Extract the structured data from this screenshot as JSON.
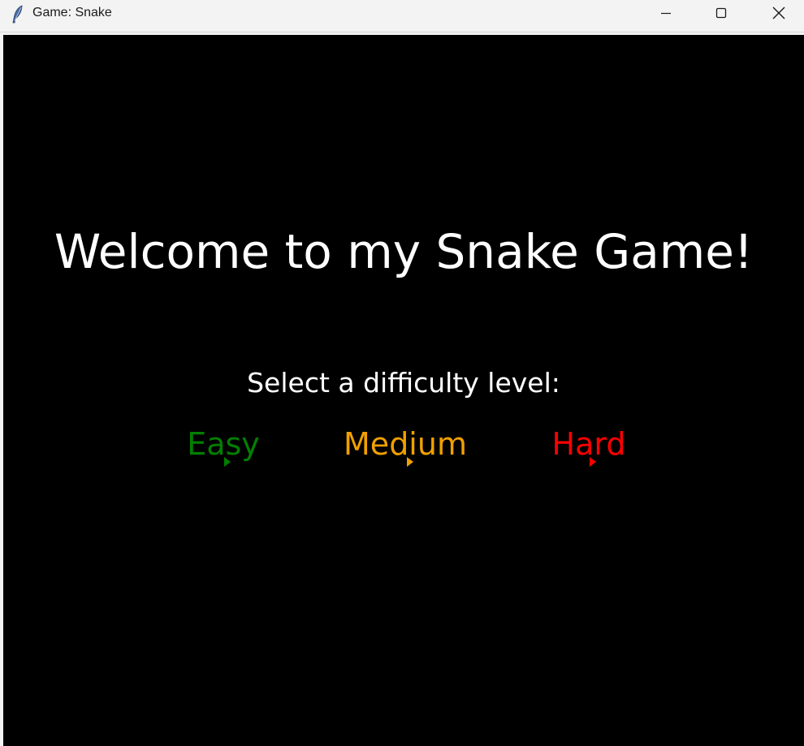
{
  "window": {
    "title": "Game: Snake",
    "controls": {
      "minimize": "minimize",
      "maximize": "maximize",
      "close": "close"
    },
    "icon": "feather-icon"
  },
  "game": {
    "welcome": "Welcome to my Snake Game!",
    "prompt": "Select a difficulty level:",
    "difficulties": [
      {
        "label": "Easy",
        "color": "#008000"
      },
      {
        "label": "Medium",
        "color": "#f0a000"
      },
      {
        "label": "Hard",
        "color": "#ff0000"
      }
    ],
    "background": "#000000",
    "text_color": "#ffffff"
  }
}
